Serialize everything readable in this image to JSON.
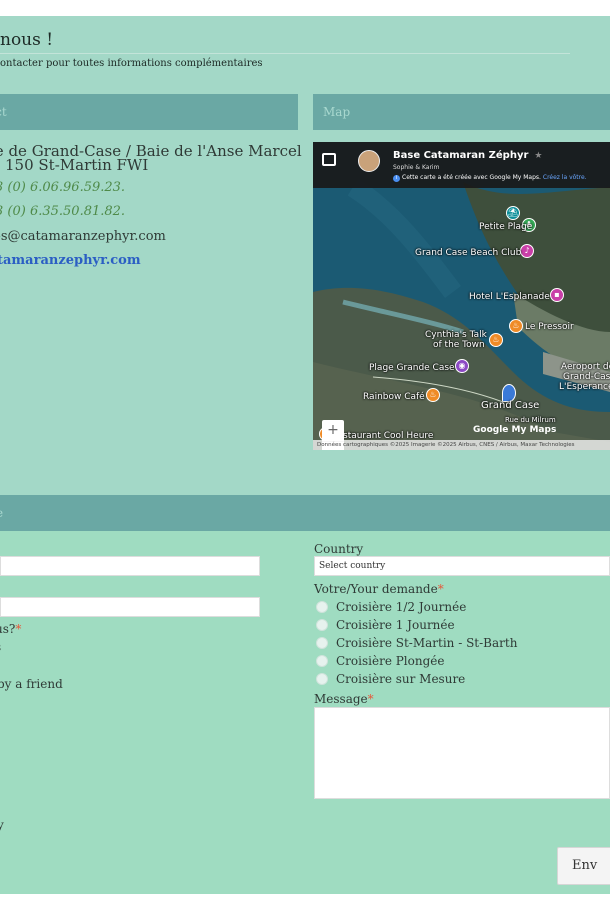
{
  "page": {
    "title": "nous !",
    "subtitle": "ontacter pour toutes informations complémentaires"
  },
  "contact": {
    "header": "act",
    "address_line1": "ie de Grand-Case / Baie de l'Anse Marcel",
    "address_line2": "150 St-Martin FWI",
    "phone1": "3 (0) 6.06.96.59.23.",
    "phone2": "3 (0) 6.35.50.81.82.",
    "email": "os@catamaranzephyr.com",
    "website": "tamaranzephyr.com"
  },
  "map": {
    "header": "Map",
    "title": "Base Catamaran Zéphyr",
    "authors": "Sophie & Karim",
    "notice": "Cette carte a été créée avec Google My Maps.",
    "notice_link": "Créez la vôtre.",
    "labels": {
      "petite_plage": "Petite Plage",
      "grand_case_beach_club": "Grand Case Beach Club",
      "hotel_esplanade": "Hotel L'Esplanade",
      "le_pressoir": "Le Pressoir",
      "cynthias_talk": "Cynthia's Talk",
      "of_the_town": "of the Town",
      "plage_grande_case": "Plage Grande Case",
      "rainbow_cafe": "Rainbow Café",
      "grand_case": "Grand Case",
      "aeroport_1": "Aeroport de",
      "aeroport_2": "Grand-Case",
      "aeroport_3": "L'Esperance",
      "cool_heure": "staurant Cool Heure",
      "rue_milrum": "Rue du Milrum"
    },
    "logo": "Google My Maps",
    "attribution": "Données cartographiques ©2025 Imagerie ©2025 Airbus, CNES / Airbus, Maxar Technologies",
    "zoom_in": "+",
    "zoom_out": "−"
  },
  "form": {
    "header": "e",
    "how_label": "us?",
    "how_required": "*",
    "how_option1": "s",
    "how_option2": "by a friend",
    "how_option3": "y",
    "country_label": "Country",
    "country_value": "Select country",
    "demande_label": "Votre/Your demande",
    "demande_required": "*",
    "options": [
      "Croisière 1/2 Journée",
      "Croisière 1 Journée",
      "Croisière St-Martin - St-Barth",
      "Croisière Plongée",
      "Croisière sur Mesure"
    ],
    "message_label": "Message",
    "message_required": "*",
    "submit_label": "Env"
  }
}
